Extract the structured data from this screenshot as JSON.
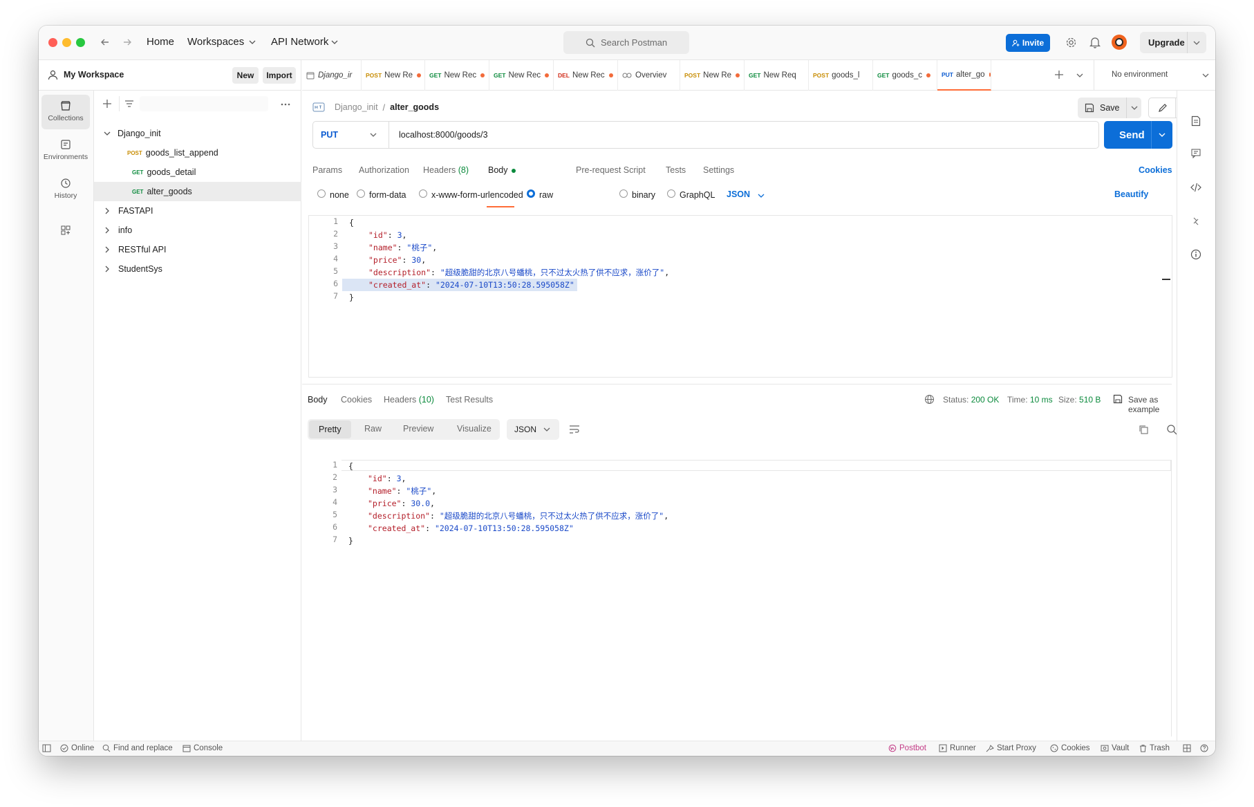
{
  "titlebar": {
    "nav": {
      "home": "Home",
      "workspaces": "Workspaces",
      "api_network": "API Network"
    },
    "search_placeholder": "Search Postman",
    "invite": "Invite",
    "upgrade": "Upgrade"
  },
  "workspace": {
    "name": "My Workspace",
    "new": "New",
    "import": "Import"
  },
  "tabs": [
    {
      "method": "",
      "label": "Django_ir",
      "dirty": false
    },
    {
      "method": "POST",
      "label": "New Re",
      "dirty": true
    },
    {
      "method": "GET",
      "label": "New Rec",
      "dirty": true
    },
    {
      "method": "GET",
      "label": "New Rec",
      "dirty": true
    },
    {
      "method": "DEL",
      "label": "New Rec",
      "dirty": true
    },
    {
      "method": "",
      "label": "Overviev",
      "dirty": false
    },
    {
      "method": "POST",
      "label": "New Re",
      "dirty": true
    },
    {
      "method": "GET",
      "label": "New Req",
      "dirty": false
    },
    {
      "method": "POST",
      "label": "goods_l",
      "dirty": false
    },
    {
      "method": "GET",
      "label": "goods_c",
      "dirty": true
    },
    {
      "method": "PUT",
      "label": "alter_go",
      "dirty": true
    }
  ],
  "environment": "No environment",
  "rail": {
    "collections": "Collections",
    "environments": "Environments",
    "history": "History"
  },
  "tree": {
    "root": "Django_init",
    "items": [
      {
        "method": "POST",
        "label": "goods_list_append"
      },
      {
        "method": "GET",
        "label": "goods_detail"
      },
      {
        "method": "GET",
        "label": "alter_goods"
      }
    ],
    "folders": [
      "FASTAPI",
      "info",
      "RESTful API",
      "StudentSys"
    ]
  },
  "request": {
    "breadcrumb_parent": "Django_init",
    "breadcrumb_sep": "/",
    "name": "alter_goods",
    "save": "Save",
    "method": "PUT",
    "url": "localhost:8000/goods/3",
    "send": "Send",
    "tabs": [
      "Params",
      "Authorization",
      "Headers",
      "(8)",
      "Body",
      "Pre-request Script",
      "Tests",
      "Settings"
    ],
    "cookies": "Cookies",
    "body_types": [
      "none",
      "form-data",
      "x-www-form-urlencoded",
      "raw",
      "binary",
      "GraphQL"
    ],
    "body_format": "JSON",
    "beautify": "Beautify"
  },
  "request_body": {
    "line_numbers": [
      "1",
      "2",
      "3",
      "4",
      "5",
      "6",
      "7"
    ],
    "open": "{",
    "close": "}",
    "id_key": "\"id\"",
    "id_val": "3",
    "name_key": "\"name\"",
    "name_val": "\"桃子\"",
    "price_key": "\"price\"",
    "price_val": "30",
    "desc_key": "\"description\"",
    "desc_val": "\"超级脆甜的北京八号蟠桃，只不过太火热了供不应求，涨价了\"",
    "created_key": "\"created_at\"",
    "created_val": "\"2024-07-10T13:50:28.595058Z\""
  },
  "response": {
    "tabs": [
      "Body",
      "Cookies",
      "Headers",
      "(10)",
      "Test Results"
    ],
    "status_label": "Status:",
    "status_value": "200 OK",
    "time_label": "Time:",
    "time_value": "10 ms",
    "size_label": "Size:",
    "size_value": "510 B",
    "save_example": "Save as example",
    "views": [
      "Pretty",
      "Raw",
      "Preview",
      "Visualize"
    ],
    "format": "JSON",
    "price_val": "30.0"
  },
  "statusbar": {
    "online": "Online",
    "find_replace": "Find and replace",
    "console": "Console",
    "postbot": "Postbot",
    "runner": "Runner",
    "start_proxy": "Start Proxy",
    "cookies": "Cookies",
    "vault": "Vault",
    "trash": "Trash"
  },
  "colors": {
    "accent": "#0c6ed8",
    "brand": "#ff6c37",
    "get": "#0b8a3c",
    "post": "#c88d05",
    "put": "#0b5bd1",
    "del": "#d12c1a"
  }
}
